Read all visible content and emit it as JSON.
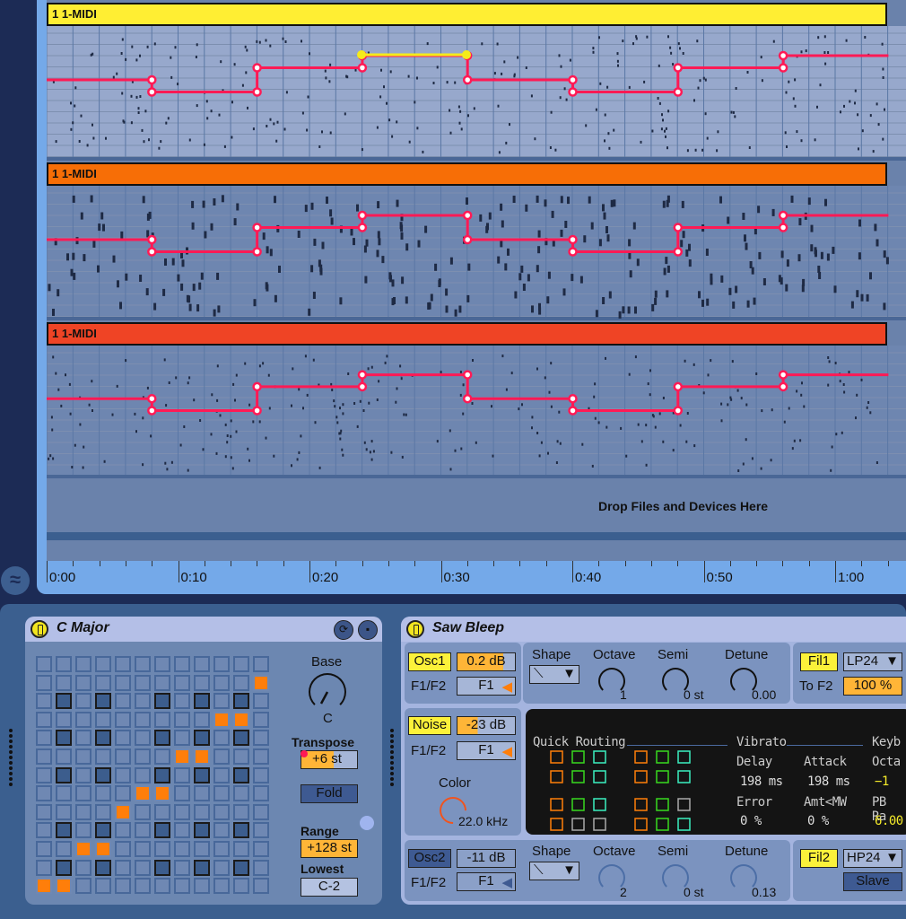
{
  "arrangement": {
    "tracks": [
      {
        "clip_name": "1 1-MIDI",
        "color": "#ffee33",
        "active_segment": true
      },
      {
        "clip_name": "1 1-MIDI",
        "color": "#f76e06"
      },
      {
        "clip_name": "1 1-MIDI",
        "color": "#ef4425"
      }
    ],
    "automation_color": "#ff1a55",
    "selected_segment_color": "#f5eb1a",
    "drop_text": "Drop Files and Devices Here",
    "timeline_labels": [
      "0:00",
      "0:10",
      "0:20",
      "0:30",
      "0:40",
      "0:50",
      "1:00"
    ],
    "wave_icon": "approx-icon"
  },
  "scale_device": {
    "title": "C Major",
    "enabled": true,
    "icons": [
      "refresh-icon",
      "save-icon"
    ],
    "grid": {
      "rows": 13,
      "cols": 12,
      "active_cells": [
        [
          1,
          11
        ],
        [
          3,
          9
        ],
        [
          3,
          10
        ],
        [
          5,
          7
        ],
        [
          5,
          8
        ],
        [
          7,
          5
        ],
        [
          7,
          6
        ],
        [
          8,
          4
        ],
        [
          10,
          2
        ],
        [
          10,
          3
        ],
        [
          12,
          0
        ],
        [
          12,
          1
        ]
      ],
      "dark_rows": [
        2,
        4,
        6,
        9,
        11
      ],
      "dark_cols": [
        1,
        3,
        6,
        8,
        10
      ]
    },
    "base_label": "Base",
    "base_value": "C",
    "transpose_label": "Transpose",
    "transpose_value": "+6",
    "transpose_unit": "st",
    "fold_label": "Fold",
    "range_label": "Range",
    "range_value": "+128 st",
    "lowest_label": "Lowest",
    "lowest_value": "C-2"
  },
  "synth_device": {
    "title": "Saw Bleep",
    "enabled": true,
    "osc1": {
      "label": "Osc1",
      "level": "0.2 dB",
      "level_fill": 0.8,
      "routing_label": "F1/F2",
      "routing_value": "F1",
      "shape_label": "Shape",
      "octave_label": "Octave",
      "octave_value": "1",
      "semi_label": "Semi",
      "semi_value": "0 st",
      "detune_label": "Detune",
      "detune_value": "0.00"
    },
    "fil1": {
      "label": "Fil1",
      "type": "LP24",
      "to_label": "To F2",
      "to_value": "100 %"
    },
    "noise": {
      "label": "Noise",
      "level": "-23 dB",
      "level_fill": 0.35,
      "routing_label": "F1/F2",
      "routing_value": "F1",
      "color_label": "Color",
      "color_value": "22.0 kHz"
    },
    "routing": {
      "title": "Quick Routing",
      "vibrato_title": "Vibrato",
      "keyboard_title": "Keyb",
      "delay_label": "Delay",
      "delay_value": "198 ms",
      "attack_label": "Attack",
      "attack_value": "198 ms",
      "octave_label": "Octa",
      "octave_value": "−1",
      "error_label": "Error",
      "error_value": "0 %",
      "amt_label": "Amt<MW",
      "amt_value": "0 %",
      "pb_label": "PB Ra",
      "pb_value": "6.00"
    },
    "osc2": {
      "label": "Osc2",
      "level": "-11 dB",
      "routing_label": "F1/F2",
      "routing_value": "F1",
      "shape_label": "Shape",
      "octave_label": "Octave",
      "octave_value": "2",
      "semi_label": "Semi",
      "semi_value": "0 st",
      "detune_label": "Detune",
      "detune_value": "0.13"
    },
    "fil2": {
      "label": "Fil2",
      "type": "HP24",
      "slave_label": "Slave"
    }
  }
}
